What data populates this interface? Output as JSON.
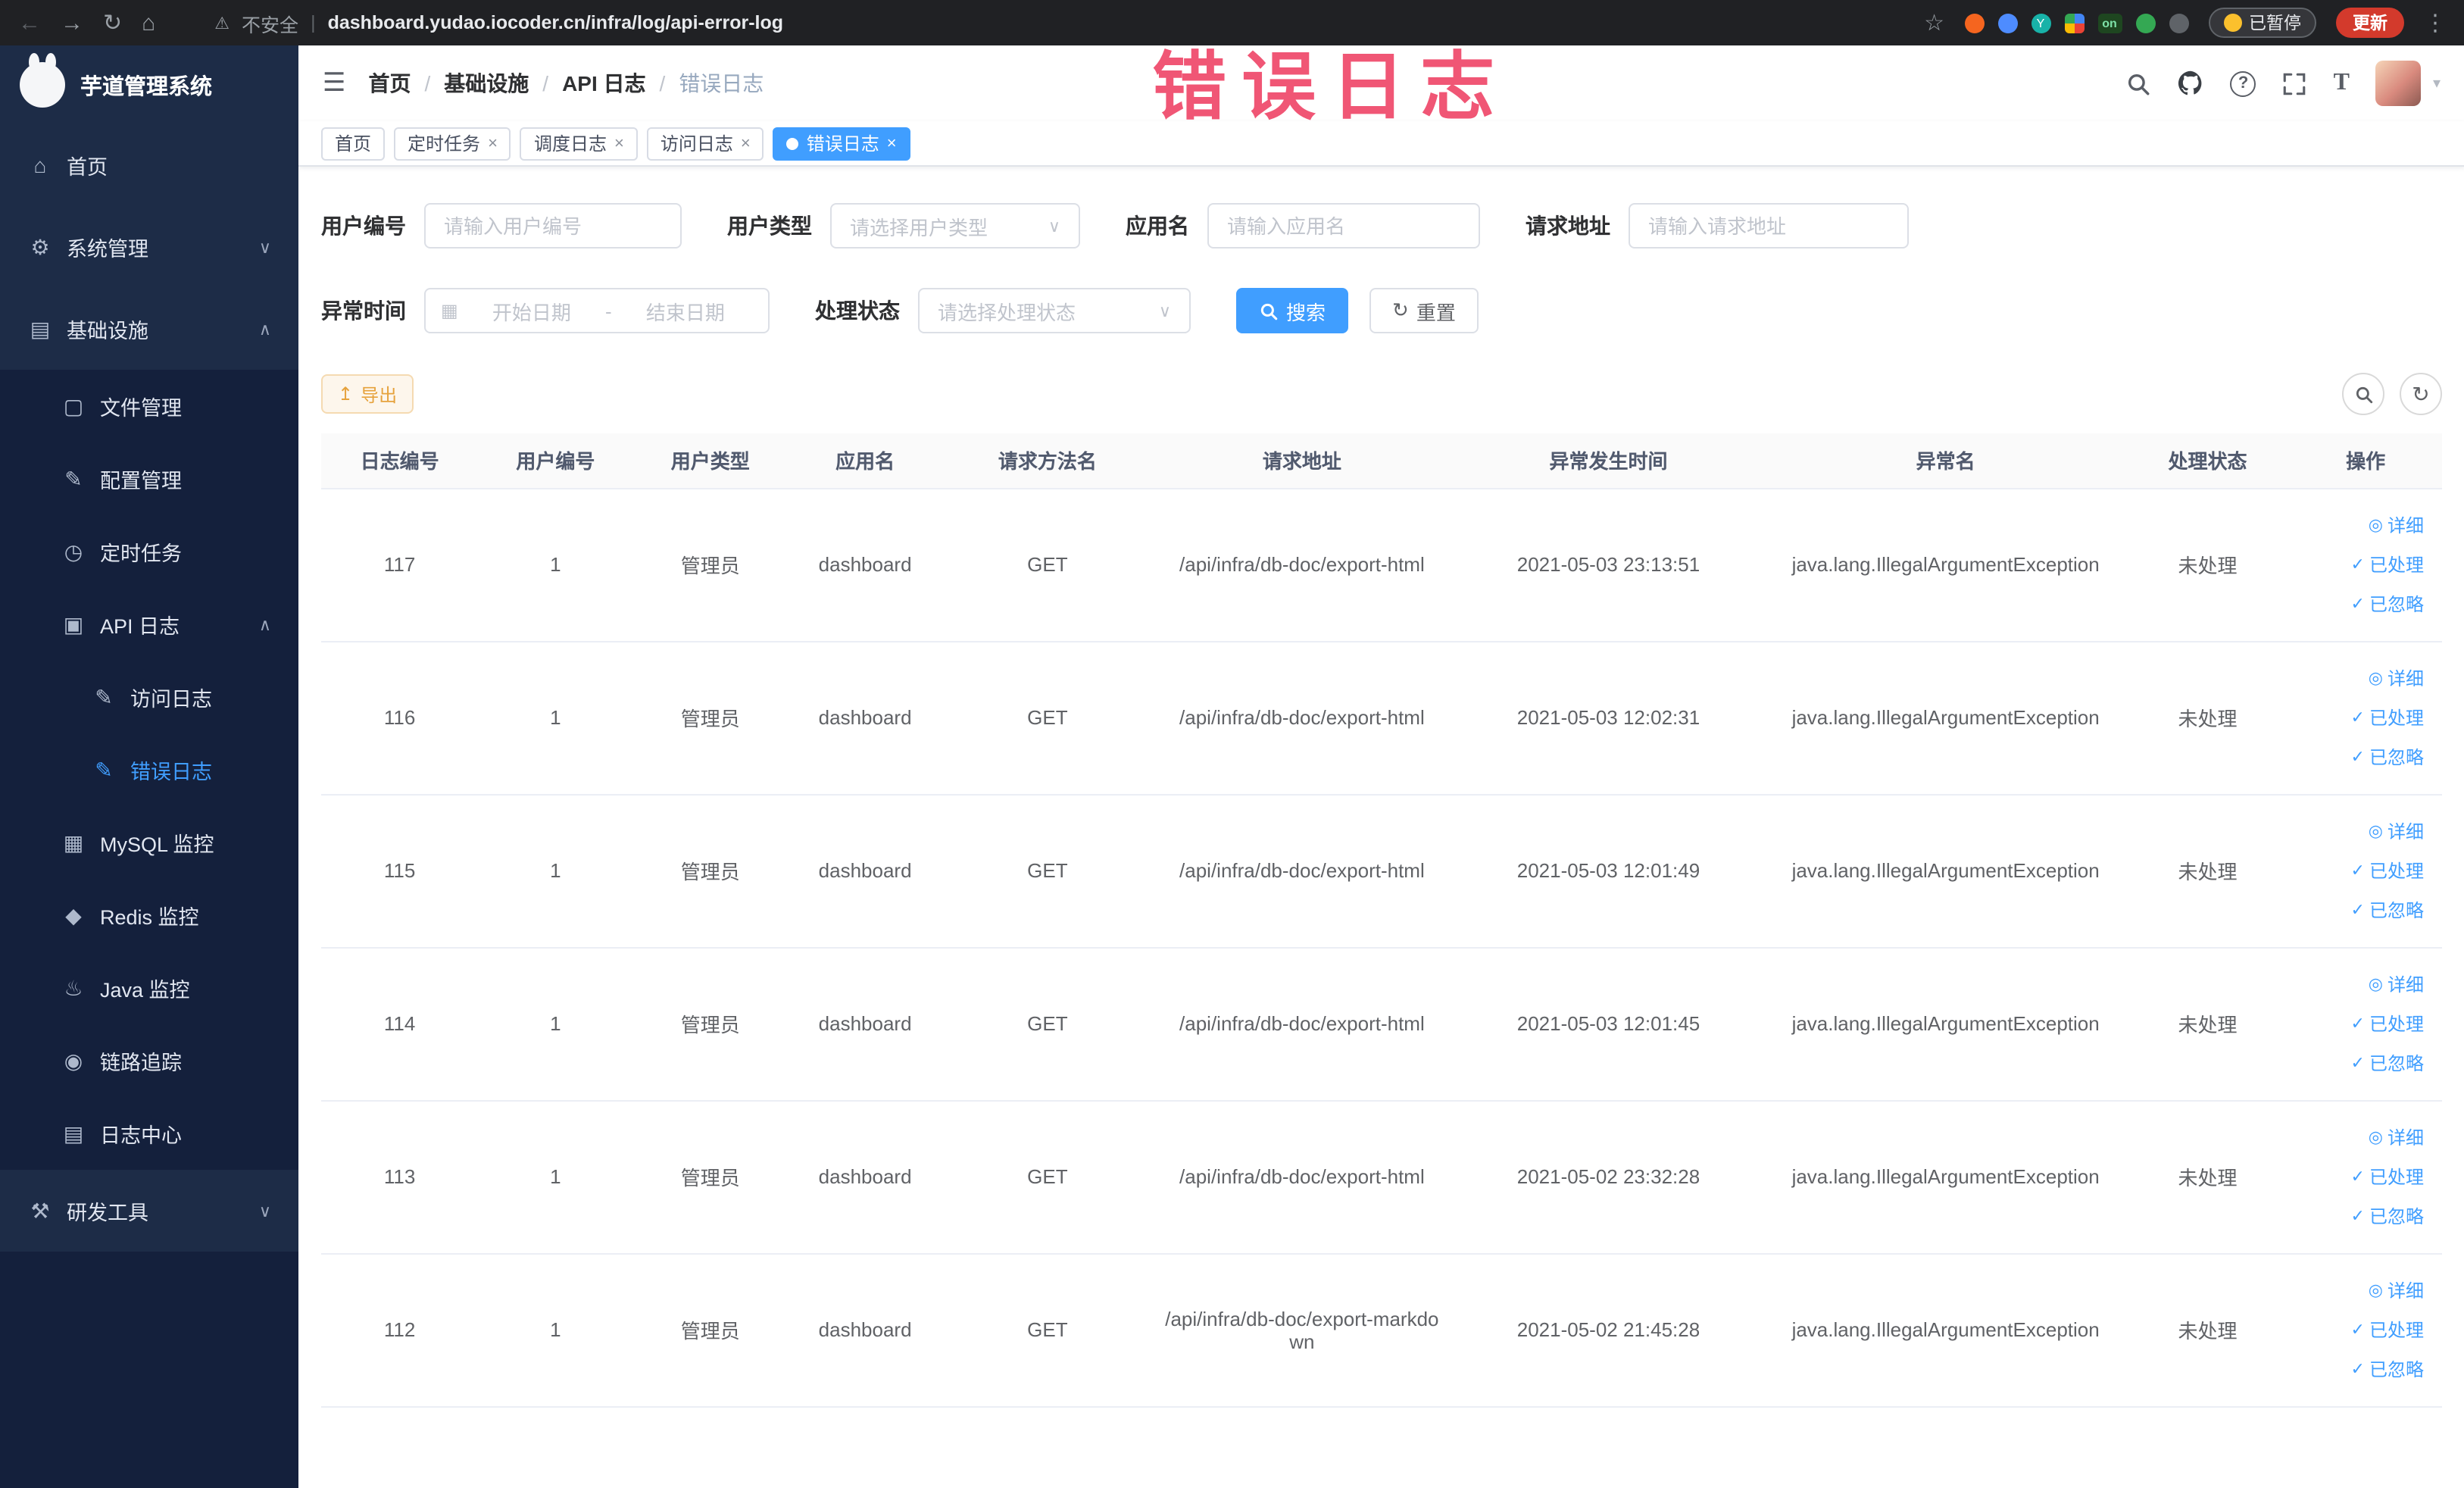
{
  "colors": {
    "accent": "#409eff",
    "warning": "#e6a23c",
    "update_red": "#d33a2c",
    "watermark_red": "#ee3f63",
    "sidebar_dark": "#14203c",
    "sidebar_light": "#1d2c47"
  },
  "browser": {
    "security_label": "不安全",
    "url_separator": "|",
    "url": "dashboard.yudao.iocoder.cn/infra/log/api-error-log",
    "on_badge": "on",
    "ext3_letter": "Y",
    "paused_badge": "已暂停",
    "update_label": "更新"
  },
  "icons": {
    "back": "←",
    "forward": "→",
    "reload": "↻",
    "home": "⌂",
    "warning": "⚠",
    "star": "☆",
    "menu_dots": "⋮",
    "hamburger": "☰",
    "caret_down": "▾",
    "chevron_down": "∨",
    "chevron_up": "∧",
    "close": "×",
    "sidebar_home": "⌂",
    "sidebar_gear": "⚙",
    "sidebar_infra": "▤",
    "sidebar_file": "▢",
    "sidebar_config": "✎",
    "sidebar_timer": "◷",
    "sidebar_api": "▣",
    "sidebar_access": "✎",
    "sidebar_error": "✎",
    "sidebar_mysql": "▦",
    "sidebar_redis": "◆",
    "sidebar_java": "♨",
    "sidebar_trace": "◉",
    "sidebar_logcenter": "▤",
    "sidebar_tools": "⚒",
    "question": "?",
    "fontsize": "T",
    "calendar": "▦",
    "refresh": "↻",
    "export": "↥",
    "eye": "◎",
    "check": "✓"
  },
  "sidebar": {
    "logo_title": "芋道管理系统",
    "menu": [
      {
        "label": "首页"
      },
      {
        "label": "系统管理"
      },
      {
        "label": "基础设施"
      },
      {
        "label": "文件管理"
      },
      {
        "label": "配置管理"
      },
      {
        "label": "定时任务"
      },
      {
        "label": "API 日志"
      },
      {
        "label": "访问日志"
      },
      {
        "label": "错误日志"
      },
      {
        "label": "MySQL 监控"
      },
      {
        "label": "Redis 监控"
      },
      {
        "label": "Java 监控"
      },
      {
        "label": "链路追踪"
      },
      {
        "label": "日志中心"
      },
      {
        "label": "研发工具"
      }
    ]
  },
  "header": {
    "breadcrumb": [
      "首页",
      "基础设施",
      "API 日志",
      "错误日志"
    ],
    "separator": "/",
    "watermark": "错误日志"
  },
  "tabs": [
    {
      "label": "首页"
    },
    {
      "label": "定时任务"
    },
    {
      "label": "调度日志"
    },
    {
      "label": "访问日志"
    },
    {
      "label": "错误日志"
    }
  ],
  "filters": {
    "user_id_label": "用户编号",
    "user_id_placeholder": "请输入用户编号",
    "user_type_label": "用户类型",
    "user_type_placeholder": "请选择用户类型",
    "app_name_label": "应用名",
    "app_name_placeholder": "请输入应用名",
    "request_url_label": "请求地址",
    "request_url_placeholder": "请输入请求地址",
    "exception_time_label": "异常时间",
    "date_start_placeholder": "开始日期",
    "date_separator": "-",
    "date_end_placeholder": "结束日期",
    "process_status_label": "处理状态",
    "process_status_placeholder": "请选择处理状态",
    "search_button": "搜索",
    "reset_button": "重置"
  },
  "toolbar": {
    "export_button": "导出"
  },
  "table": {
    "headers": [
      "日志编号",
      "用户编号",
      "用户类型",
      "应用名",
      "请求方法名",
      "请求地址",
      "异常发生时间",
      "异常名",
      "处理状态",
      "操作"
    ],
    "actions": [
      "详细",
      "已处理",
      "已忽略"
    ],
    "rows": [
      {
        "id": "117",
        "user_id": "1",
        "user_type": "管理员",
        "app": "dashboard",
        "method": "GET",
        "url": "/api/infra/db-doc/export-html",
        "time": "2021-05-03 23:13:51",
        "exception": "java.lang.IllegalArgumentException",
        "status": "未处理"
      },
      {
        "id": "116",
        "user_id": "1",
        "user_type": "管理员",
        "app": "dashboard",
        "method": "GET",
        "url": "/api/infra/db-doc/export-html",
        "time": "2021-05-03 12:02:31",
        "exception": "java.lang.IllegalArgumentException",
        "status": "未处理"
      },
      {
        "id": "115",
        "user_id": "1",
        "user_type": "管理员",
        "app": "dashboard",
        "method": "GET",
        "url": "/api/infra/db-doc/export-html",
        "time": "2021-05-03 12:01:49",
        "exception": "java.lang.IllegalArgumentException",
        "status": "未处理"
      },
      {
        "id": "114",
        "user_id": "1",
        "user_type": "管理员",
        "app": "dashboard",
        "method": "GET",
        "url": "/api/infra/db-doc/export-html",
        "time": "2021-05-03 12:01:45",
        "exception": "java.lang.IllegalArgumentException",
        "status": "未处理"
      },
      {
        "id": "113",
        "user_id": "1",
        "user_type": "管理员",
        "app": "dashboard",
        "method": "GET",
        "url": "/api/infra/db-doc/export-html",
        "time": "2021-05-02 23:32:28",
        "exception": "java.lang.IllegalArgumentException",
        "status": "未处理"
      },
      {
        "id": "112",
        "user_id": "1",
        "user_type": "管理员",
        "app": "dashboard",
        "method": "GET",
        "url": "/api/infra/db-doc/export-markdown",
        "time": "2021-05-02 21:45:28",
        "exception": "java.lang.IllegalArgumentException",
        "status": "未处理"
      }
    ]
  }
}
